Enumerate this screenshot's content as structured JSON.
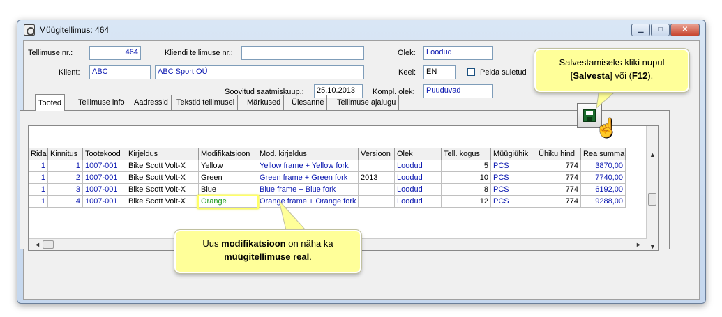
{
  "window": {
    "title": "Müügitellimus: 464",
    "min": "▁",
    "max": "□",
    "close": "✕"
  },
  "form": {
    "order_no_label": "Tellimuse nr.:",
    "order_no": "464",
    "client_order_label": "Kliendi tellimuse nr.:",
    "client_order": "",
    "status_label": "Olek:",
    "status": "Loodud",
    "client_label": "Klient:",
    "client_code": "ABC",
    "client_name": "ABC Sport OÜ",
    "lang_label": "Keel:",
    "lang": "EN",
    "hide_closed_label": "Peida suletud",
    "ship_date_label": "Soovitud saatmiskuup.:",
    "ship_date": "25.10.2013",
    "compl_label": "Kompl. olek:",
    "compl": "Puuduvad"
  },
  "tabs": [
    "Tooted",
    "Tellimuse info",
    "Aadressid",
    "Tekstid tellimusel",
    "Märkused",
    "Ülesanne",
    "Tellimuse ajalugu"
  ],
  "grid": {
    "headers": [
      "Rida",
      "Kinnitus",
      "Tootekood",
      "Kirjeldus",
      "Modifikatsioon",
      "Mod. kirjeldus",
      "Versioon",
      "Olek",
      "Tell. kogus",
      "Müügiühik",
      "Ühiku hind",
      "Rea summa"
    ],
    "rows": [
      [
        "1",
        "1",
        "1007-001",
        "Bike Scott Volt-X",
        "Yellow",
        "Yellow frame + Yellow fork",
        "",
        "Loodud",
        "5",
        "PCS",
        "774",
        "3870,00"
      ],
      [
        "1",
        "2",
        "1007-001",
        "Bike Scott Volt-X",
        "Green",
        "Green frame + Green fork",
        "2013",
        "Loodud",
        "10",
        "PCS",
        "774",
        "7740,00"
      ],
      [
        "1",
        "3",
        "1007-001",
        "Bike Scott Volt-X",
        "Blue",
        "Blue frame + Blue fork",
        "",
        "Loodud",
        "8",
        "PCS",
        "774",
        "6192,00"
      ],
      [
        "1",
        "4",
        "1007-001",
        "Bike Scott Volt-X",
        "Orange",
        "Orange frame + Orange fork",
        "",
        "Loodud",
        "12",
        "PCS",
        "774",
        "9288,00"
      ]
    ]
  },
  "callout_save": {
    "line1": "Salvestamiseks kliki nupul",
    "pre": "[",
    "bold1": "Salvesta",
    "mid": "] või (",
    "bold2": "F12",
    "post": ")."
  },
  "callout_mod": {
    "pre": "Uus ",
    "bold1": "modifikatsioon",
    "mid": " on näha ka",
    "bold2": "müügitellimuse real",
    "post": "."
  },
  "colors": {
    "link_blue": "#0a17b0",
    "callout_bg": "#ffff99",
    "mod_green": "#1f9a1f"
  },
  "icons": {
    "save": "floppy-disk-icon",
    "cursor": "hand-pointer-icon"
  }
}
